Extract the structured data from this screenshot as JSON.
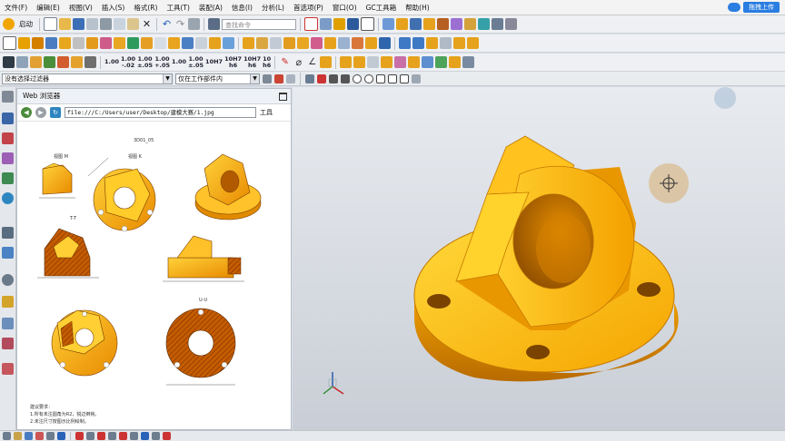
{
  "menu": {
    "items": [
      "文件(F)",
      "编辑(E)",
      "视图(V)",
      "插入(S)",
      "格式(R)",
      "工具(T)",
      "装配(A)",
      "信息(I)",
      "分析(L)",
      "首选项(P)",
      "窗口(O)",
      "GC工具箱",
      "帮助(H)"
    ],
    "upload_label": "拖拽上传"
  },
  "toolbar": {
    "start_label": "启动",
    "search_placeholder": "查找命令",
    "tolerance_labels": [
      {
        "top": "1.00",
        "bottom": ""
      },
      {
        "top": "1.00",
        "bottom": "-.02"
      },
      {
        "top": "1.00",
        "bottom": "±.05"
      },
      {
        "top": "1.00",
        "bottom": "+.05"
      },
      {
        "top": "1.00",
        "bottom": ""
      },
      {
        "top": "1.00",
        "bottom": "±.05"
      },
      {
        "top": "10H7",
        "bottom": ""
      },
      {
        "top": "10H7",
        "bottom": "h6"
      },
      {
        "top": "10H7",
        "bottom": "h6"
      },
      {
        "top": "10",
        "bottom": "h6"
      }
    ]
  },
  "selection_bar": {
    "filter_value": "没有选择过滤器",
    "scope_value": "仅在工作部件内"
  },
  "web_browser": {
    "title": "Web 浏览器",
    "url": "file:///C:/Users/user/Desktop/建模大赛/1.jpg",
    "tools_label": "工具",
    "drawing": {
      "sheet_id": "3D01_05",
      "view_m": "视图 M",
      "view_k": "视图 K",
      "section_tt": "T-T",
      "section_u": "U-U",
      "notes_heading": "建议要求：",
      "note_line_1": "1.所有未注圆角为R2，锐边倒钝。",
      "note_line_2": "2.未注尺寸按图示比例绘制。"
    }
  },
  "colors": {
    "accent": "#2a7de1",
    "part_orange": "#f5a400",
    "part_light": "#ffcd2e",
    "part_dark": "#b86b00"
  }
}
